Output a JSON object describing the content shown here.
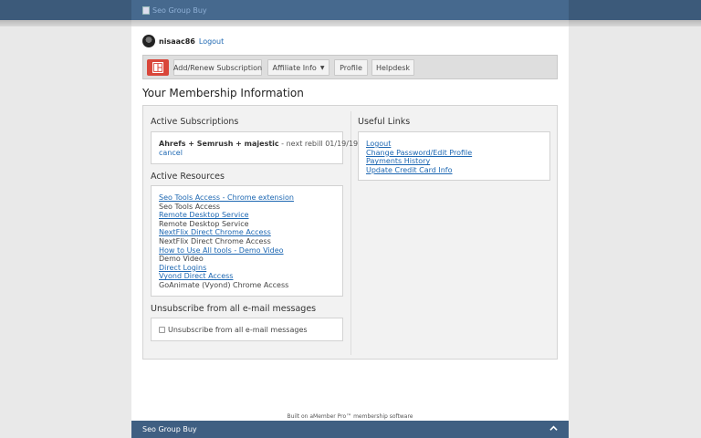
{
  "header": {
    "logo_alt": "Seo Group Buy"
  },
  "user": {
    "username": "nisaac86",
    "logout_label": "Logout"
  },
  "menu": {
    "home_icon": "dashboard-grid-icon",
    "items": [
      {
        "label": "Add/Renew Subscription"
      },
      {
        "label": "Affiliate Info",
        "dropdown": true
      },
      {
        "label": "Profile"
      },
      {
        "label": "Helpdesk"
      }
    ]
  },
  "page_title": "Your Membership Information",
  "active_subscriptions": {
    "title": "Active Subscriptions",
    "name": "Ahrefs + Semrush + majestic",
    "rebill": " - next rebill 01/19/19",
    "cancel_label": "cancel"
  },
  "active_resources": {
    "title": "Active Resources",
    "items": [
      {
        "label": "Seo Tools Access - Chrome extension",
        "link": true
      },
      {
        "label": "Seo Tools Access",
        "link": false
      },
      {
        "label": "Remote Desktop Service",
        "link": true
      },
      {
        "label": "Remote Desktop Service",
        "link": false
      },
      {
        "label": "NextFlix Direct Chrome Access",
        "link": true
      },
      {
        "label": "NextFlix Direct Chrome Access",
        "link": false
      },
      {
        "label": "How to Use All tools - Demo Video",
        "link": true
      },
      {
        "label": "Demo Video",
        "link": false
      },
      {
        "label": "Direct Logins",
        "link": true
      },
      {
        "label": "Vyond Direct Access",
        "link": true
      },
      {
        "label": "GoAnimate (Vyond) Chrome Access",
        "link": false
      }
    ]
  },
  "unsubscribe": {
    "title": "Unsubscribe from all e-mail messages",
    "checkbox_label": "Unsubscribe from all e-mail messages",
    "checked": false
  },
  "useful_links": {
    "title": "Useful Links",
    "items": [
      {
        "label": "Logout"
      },
      {
        "label": "Change Password/Edit Profile"
      },
      {
        "label": "Payments History"
      },
      {
        "label": "Update Credit Card Info"
      }
    ]
  },
  "footer": {
    "powered_by": "Built on aMember Pro™ membership software",
    "bar_title": "Seo Group Buy",
    "scroll_top_icon": "chevron-up-icon"
  },
  "colors": {
    "header": "#46698e",
    "link": "#1d67b2",
    "home_button": "#d9463a",
    "footer_bar": "#3f5f82"
  }
}
